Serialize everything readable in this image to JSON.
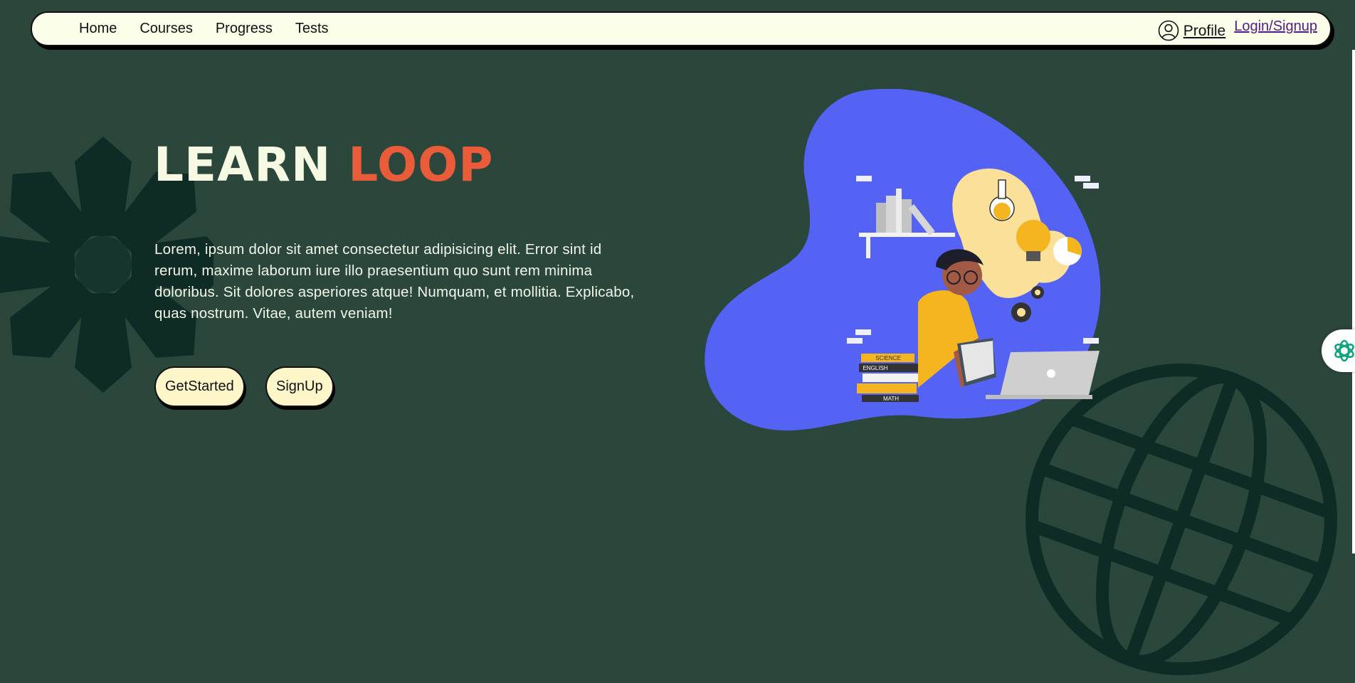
{
  "nav": {
    "links": [
      "Home",
      "Courses",
      "Progress",
      "Tests"
    ],
    "profile_label": "Profile",
    "login_label": "Login/Signup"
  },
  "hero": {
    "title_part1": "LEARN",
    "title_part2": "LOOP",
    "description": "Lorem, ipsum dolor sit amet consectetur adipisicing elit. Error sint id rerum, maxime laborum iure illo praesentium quo sunt rem minima doloribus. Sit dolores asperiores atque! Numquam, et mollitia. Explicabo, quas nostrum. Vitae, autem veniam!",
    "get_started_label": "GetStarted",
    "signup_label": "SignUp"
  },
  "illustration": {
    "book_labels": [
      "SCIENCE",
      "ENGLISH",
      "MATH"
    ]
  },
  "colors": {
    "background": "#2b463b",
    "nav_bg": "#fbffe9",
    "title_light": "#f6fae3",
    "title_accent": "#ea5b3a",
    "button_bg": "#fef6c9",
    "blob": "#5563f5",
    "helper_icon": "#10a37f"
  },
  "icons": {
    "profile": "user-circle-icon",
    "helper": "openai-icon",
    "decor_left": "flower-decor-icon",
    "decor_right": "globe-decor-icon"
  }
}
